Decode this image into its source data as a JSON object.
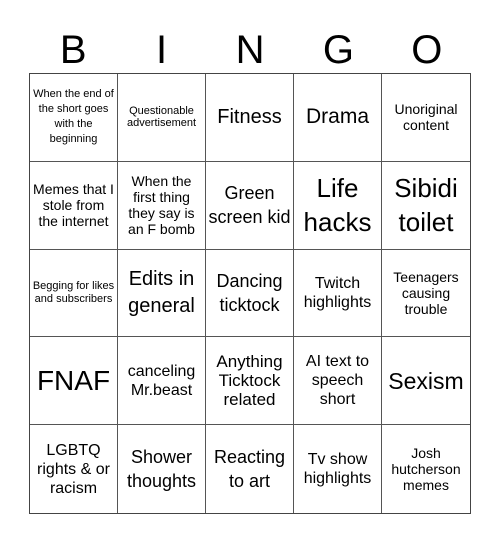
{
  "header": [
    "B",
    "I",
    "N",
    "G",
    "O"
  ],
  "cells": [
    "When the end of the short goes with the beginning",
    "Questionable advertisement",
    "Fitness",
    "Drama",
    "Unoriginal content",
    "Memes that I stole from the internet",
    "When the first thing they say is an F bomb",
    "Green screen kid",
    "Life hacks",
    "Sibidi toilet",
    "Begging for likes and subscribers",
    "Edits in general",
    "Dancing ticktock",
    "Twitch highlights",
    "Teenagers causing trouble",
    "FNAF",
    "canceling Mr.beast",
    "Anything Ticktock related",
    "AI text to speech short",
    "Sexism",
    "LGBTQ rights & or racism",
    "Shower thoughts",
    "Reacting to art",
    "Tv show highlights",
    "Josh hutcherson memes"
  ]
}
